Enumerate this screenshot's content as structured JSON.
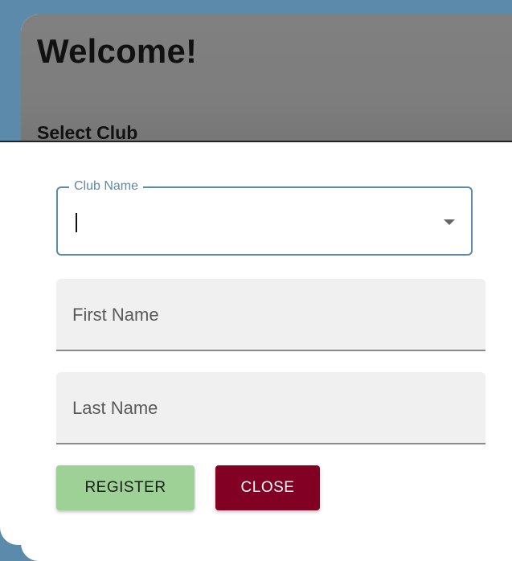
{
  "header": {
    "title": "Welcome!",
    "subtitle": "Select Club"
  },
  "form": {
    "club_name": {
      "label": "Club Name",
      "value": ""
    },
    "first_name": {
      "placeholder": "First Name",
      "value": ""
    },
    "last_name": {
      "placeholder": "Last Name",
      "value": ""
    }
  },
  "buttons": {
    "register_label": "REGISTER",
    "close_label": "CLOSE"
  },
  "colors": {
    "background": "#5b8aab",
    "accent": "#5b8aab",
    "register": "#9ed196",
    "close": "#820024"
  }
}
